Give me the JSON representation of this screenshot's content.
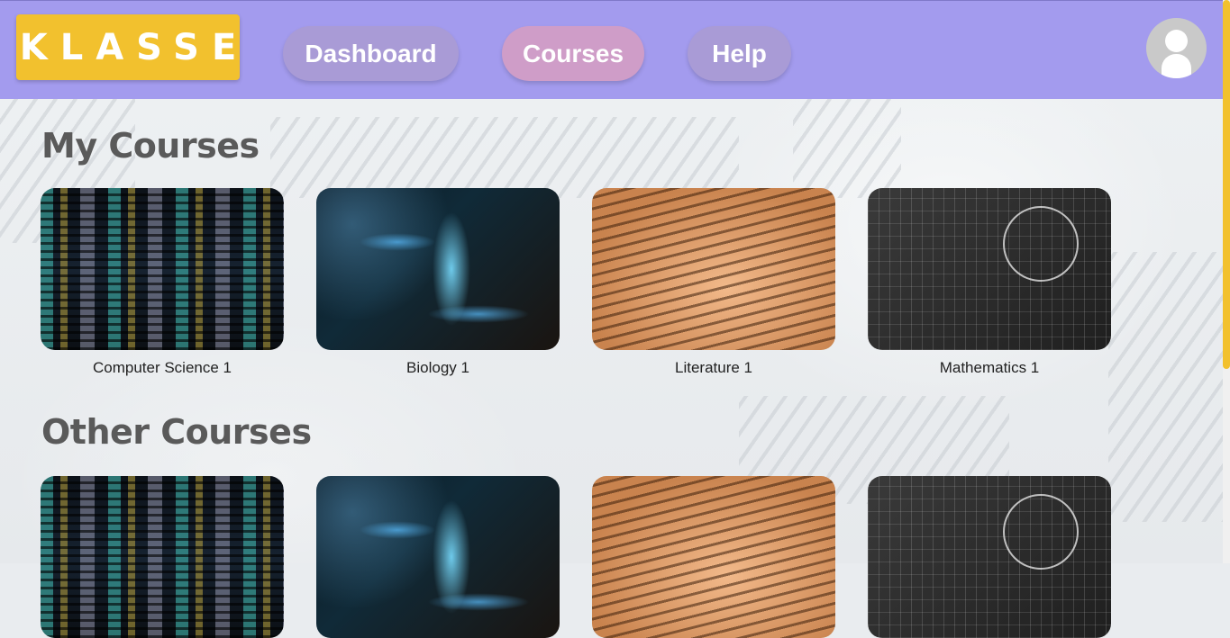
{
  "app": {
    "logo_text": "KLASSE"
  },
  "nav": {
    "items": [
      {
        "label": "Dashboard",
        "color": "#a99bd6"
      },
      {
        "label": "Courses",
        "color": "#cf9dc8"
      },
      {
        "label": "Help",
        "color": "#a99bd6"
      }
    ]
  },
  "user": {
    "avatar_icon": "user-avatar-icon"
  },
  "colors": {
    "header": "#a39bee",
    "logo_bg": "#f2c12e",
    "scrollbar": "#f2c12e"
  },
  "sections": {
    "my_courses": {
      "title": "My Courses",
      "courses": [
        {
          "name": "Computer Science 1",
          "image": "code-screen"
        },
        {
          "name": "Biology 1",
          "image": "dna-helix"
        },
        {
          "name": "Literature 1",
          "image": "book-page"
        },
        {
          "name": "Mathematics 1",
          "image": "chalkboard-equations"
        }
      ]
    },
    "other_courses": {
      "title": "Other Courses",
      "courses": [
        {
          "name": "",
          "image": "code-screen"
        },
        {
          "name": "",
          "image": "dna-helix"
        },
        {
          "name": "",
          "image": "book-page"
        },
        {
          "name": "",
          "image": "chalkboard-equations"
        }
      ]
    }
  }
}
